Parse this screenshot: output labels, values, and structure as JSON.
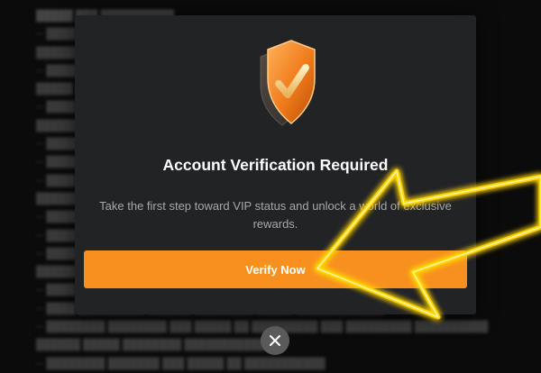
{
  "modal": {
    "title": "Account Verification Required",
    "description": "Take the first step toward VIP status and unlock a world of exclusive rewards.",
    "verify_label": "Verify Now",
    "shield_icon": "verified-shield-icon",
    "close_icon": "close-icon"
  },
  "colors": {
    "accent": "#f7901e",
    "modal_bg": "#222325",
    "overlay_arrow": "#ffd400"
  }
}
